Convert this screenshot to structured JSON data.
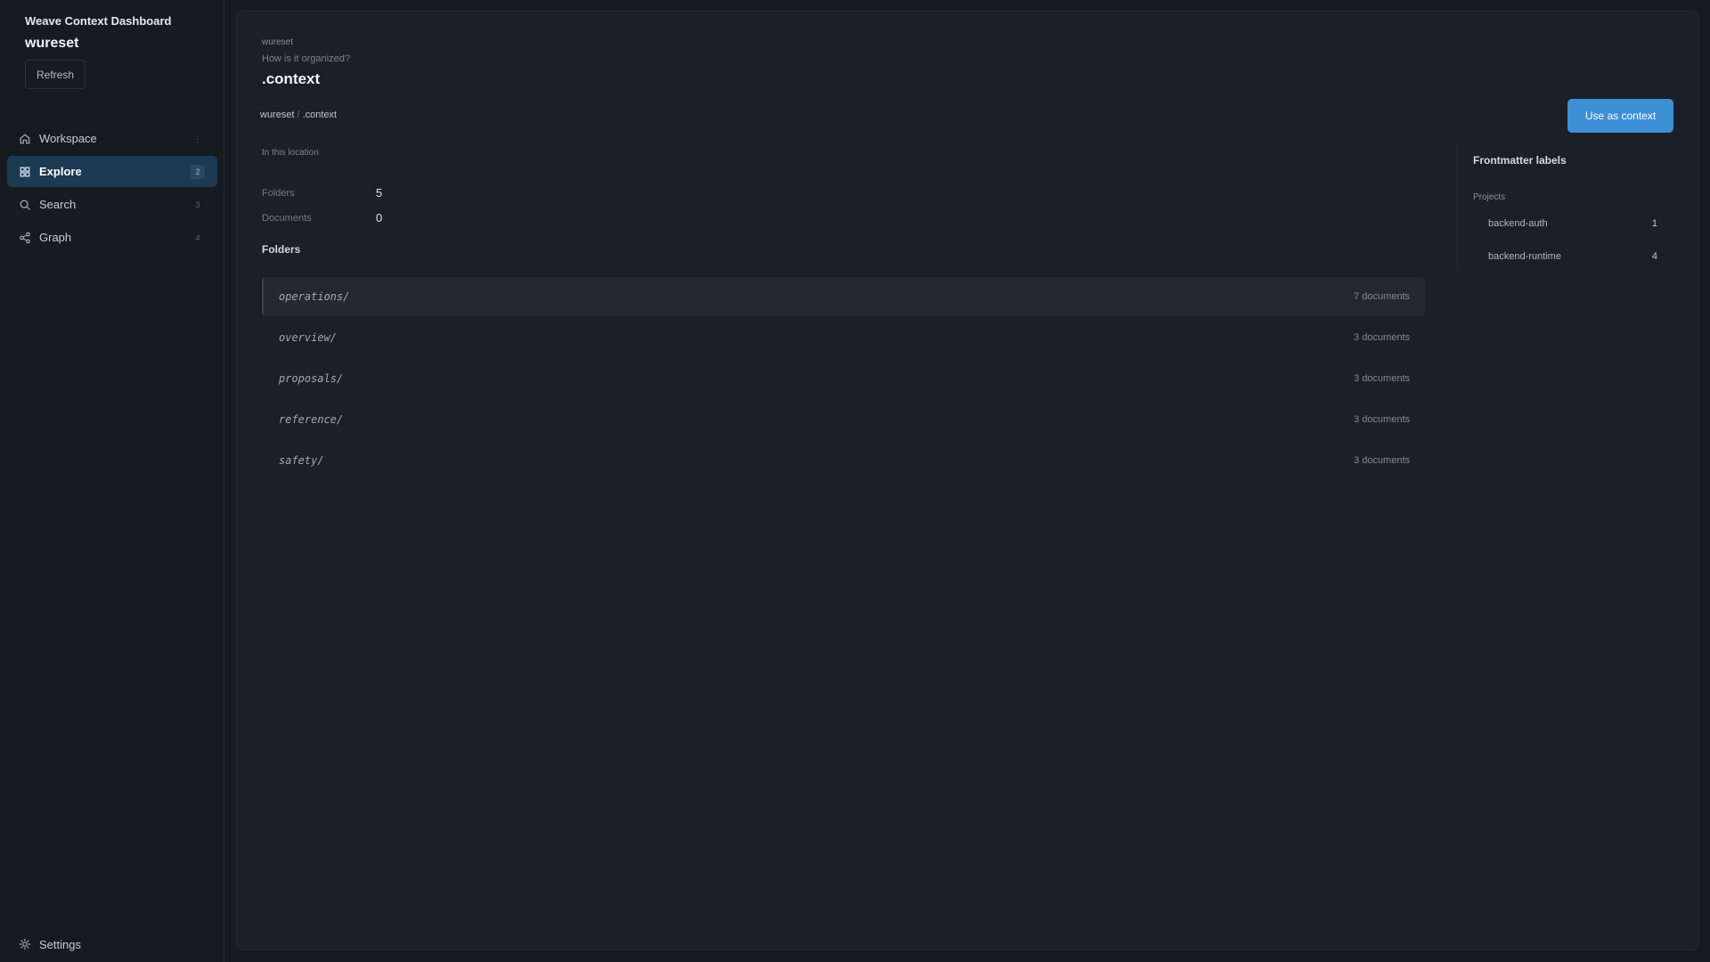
{
  "app": {
    "title": "Weave Context Dashboard"
  },
  "sidebar": {
    "workspace_name": "wureset",
    "refresh_label": "Refresh",
    "items": [
      {
        "label": "Workspace",
        "icon": "home-icon",
        "active": false
      },
      {
        "label": "Explore",
        "icon": "grid-icon",
        "active": true
      },
      {
        "label": "Search",
        "icon": "search-icon",
        "active": false
      },
      {
        "label": "Graph",
        "icon": "share-icon",
        "active": false
      }
    ],
    "settings_label": "Settings"
  },
  "main": {
    "eyebrow": "wureset",
    "subtitle": "How is it organized?",
    "title": ".context",
    "breadcrumb": [
      "wureset",
      "/",
      ".context"
    ],
    "use_button_label": "Use as context",
    "section_label": "In this location",
    "stats": [
      {
        "label": "Folders",
        "value": "5"
      },
      {
        "label": "Documents",
        "value": "0"
      }
    ],
    "folders_heading": "Folders",
    "folders": [
      {
        "name": "operations/",
        "count": "7 documents"
      },
      {
        "name": "overview/",
        "count": "3 documents"
      },
      {
        "name": "proposals/",
        "count": "3 documents"
      },
      {
        "name": "reference/",
        "count": "3 documents"
      },
      {
        "name": "safety/",
        "count": "3 documents"
      }
    ]
  },
  "frontmatter": {
    "title": "Frontmatter labels",
    "group_label": "Projects",
    "items": [
      {
        "name": "backend-auth",
        "count": "1"
      },
      {
        "name": "backend-runtime",
        "count": "4"
      }
    ]
  },
  "colors": {
    "accent": "#3d8fd6",
    "active_nav": "#1c3a52",
    "background": "#161a21",
    "panel": "#1b1f27"
  }
}
